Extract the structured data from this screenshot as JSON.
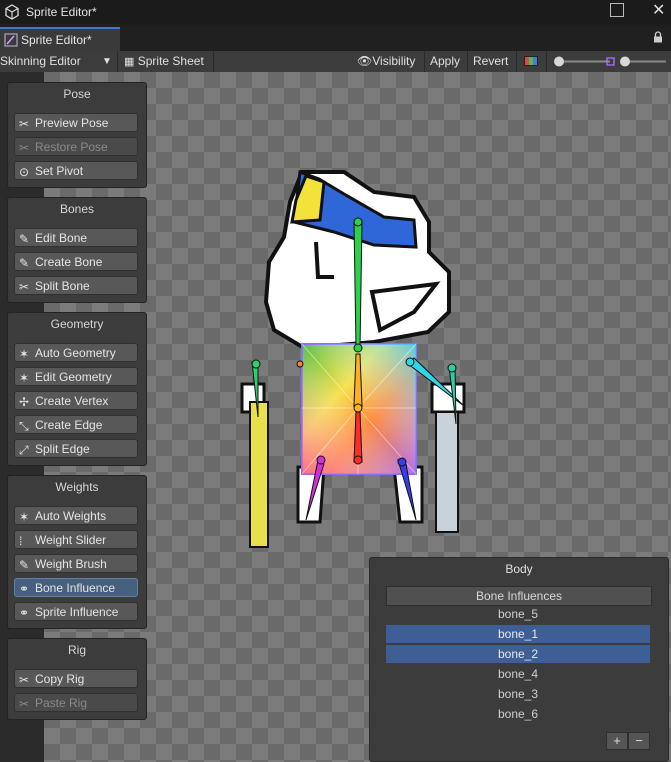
{
  "window": {
    "title": "Sprite Editor*"
  },
  "tab": {
    "label": "Sprite Editor*"
  },
  "toolbar": {
    "mode": "Skinning Editor",
    "sprite_sheet": "Sprite Sheet",
    "visibility": "Visibility",
    "apply": "Apply",
    "revert": "Revert"
  },
  "panels": {
    "pose": {
      "title": "Pose",
      "buttons": [
        {
          "label": "Preview Pose",
          "icon": "preview-pose-icon",
          "state": "normal"
        },
        {
          "label": "Restore Pose",
          "icon": "restore-pose-icon",
          "state": "disabled"
        },
        {
          "label": "Set Pivot",
          "icon": "pivot-icon",
          "state": "normal"
        }
      ]
    },
    "bones": {
      "title": "Bones",
      "buttons": [
        {
          "label": "Edit Bone",
          "icon": "edit-bone-icon",
          "state": "normal"
        },
        {
          "label": "Create Bone",
          "icon": "create-bone-icon",
          "state": "normal"
        },
        {
          "label": "Split Bone",
          "icon": "split-bone-icon",
          "state": "normal"
        }
      ]
    },
    "geometry": {
      "title": "Geometry",
      "buttons": [
        {
          "label": "Auto Geometry",
          "icon": "auto-geometry-icon",
          "state": "normal"
        },
        {
          "label": "Edit Geometry",
          "icon": "edit-geometry-icon",
          "state": "normal"
        },
        {
          "label": "Create Vertex",
          "icon": "create-vertex-icon",
          "state": "normal"
        },
        {
          "label": "Create Edge",
          "icon": "create-edge-icon",
          "state": "normal"
        },
        {
          "label": "Split Edge",
          "icon": "split-edge-icon",
          "state": "normal"
        }
      ]
    },
    "weights": {
      "title": "Weights",
      "buttons": [
        {
          "label": "Auto Weights",
          "icon": "auto-weights-icon",
          "state": "normal"
        },
        {
          "label": "Weight Slider",
          "icon": "weight-slider-icon",
          "state": "normal"
        },
        {
          "label": "Weight Brush",
          "icon": "weight-brush-icon",
          "state": "normal"
        },
        {
          "label": "Bone Influence",
          "icon": "bone-influence-icon",
          "state": "active"
        },
        {
          "label": "Sprite Influence",
          "icon": "sprite-influence-icon",
          "state": "normal"
        }
      ]
    },
    "rig": {
      "title": "Rig",
      "buttons": [
        {
          "label": "Copy Rig",
          "icon": "copy-rig-icon",
          "state": "normal"
        },
        {
          "label": "Paste Rig",
          "icon": "paste-rig-icon",
          "state": "disabled"
        }
      ]
    }
  },
  "body_panel": {
    "title": "Body",
    "list_header": "Bone Influences",
    "items": [
      {
        "label": "bone_5",
        "selected": false
      },
      {
        "label": "bone_1",
        "selected": true
      },
      {
        "label": "bone_2",
        "selected": true
      },
      {
        "label": "bone_4",
        "selected": false
      },
      {
        "label": "bone_3",
        "selected": false
      },
      {
        "label": "bone_6",
        "selected": false
      }
    ],
    "add": "+",
    "remove": "−"
  },
  "colors": {
    "accent": "#3a78d0",
    "selected_row": "#3e5f95",
    "active_button": "#46607e"
  }
}
